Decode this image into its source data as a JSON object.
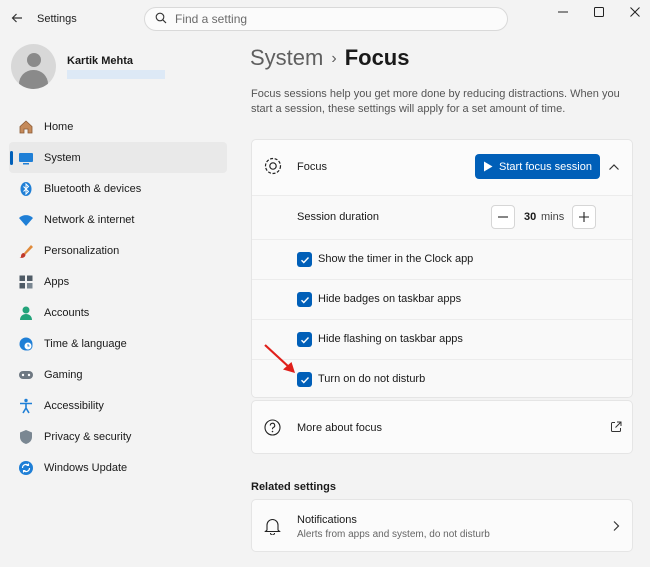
{
  "window": {
    "title": "Settings",
    "search_placeholder": "Find a setting"
  },
  "profile": {
    "name": "Kartik Mehta"
  },
  "sidebar": {
    "items": [
      {
        "label": "Home",
        "icon": "home-icon"
      },
      {
        "label": "System",
        "icon": "system-icon",
        "active": true
      },
      {
        "label": "Bluetooth & devices",
        "icon": "bluetooth-icon"
      },
      {
        "label": "Network & internet",
        "icon": "wifi-icon"
      },
      {
        "label": "Personalization",
        "icon": "brush-icon"
      },
      {
        "label": "Apps",
        "icon": "apps-icon"
      },
      {
        "label": "Accounts",
        "icon": "accounts-icon"
      },
      {
        "label": "Time & language",
        "icon": "globe-clock-icon"
      },
      {
        "label": "Gaming",
        "icon": "gamepad-icon"
      },
      {
        "label": "Accessibility",
        "icon": "accessibility-icon"
      },
      {
        "label": "Privacy & security",
        "icon": "shield-icon"
      },
      {
        "label": "Windows Update",
        "icon": "update-icon"
      }
    ]
  },
  "header": {
    "parent": "System",
    "separator": "›",
    "current": "Focus",
    "description": "Focus sessions help you get more done by reducing distractions. When you start a session, these settings will apply for a set amount of time."
  },
  "focus": {
    "label": "Focus",
    "start_button": "Start focus session",
    "session_duration_label": "Session duration",
    "duration_value": "30",
    "duration_unit": "mins",
    "options": [
      {
        "label": "Show the timer in the Clock app",
        "checked": true
      },
      {
        "label": "Hide badges on taskbar apps",
        "checked": true
      },
      {
        "label": "Hide flashing on taskbar apps",
        "checked": true
      },
      {
        "label": "Turn on do not disturb",
        "checked": true
      }
    ]
  },
  "more_about": {
    "label": "More about focus"
  },
  "related": {
    "header": "Related settings",
    "notifications_title": "Notifications",
    "notifications_subtitle": "Alerts from apps and system, do not disturb"
  },
  "colors": {
    "accent": "#005fb8",
    "annotation_arrow": "#e0201b"
  }
}
